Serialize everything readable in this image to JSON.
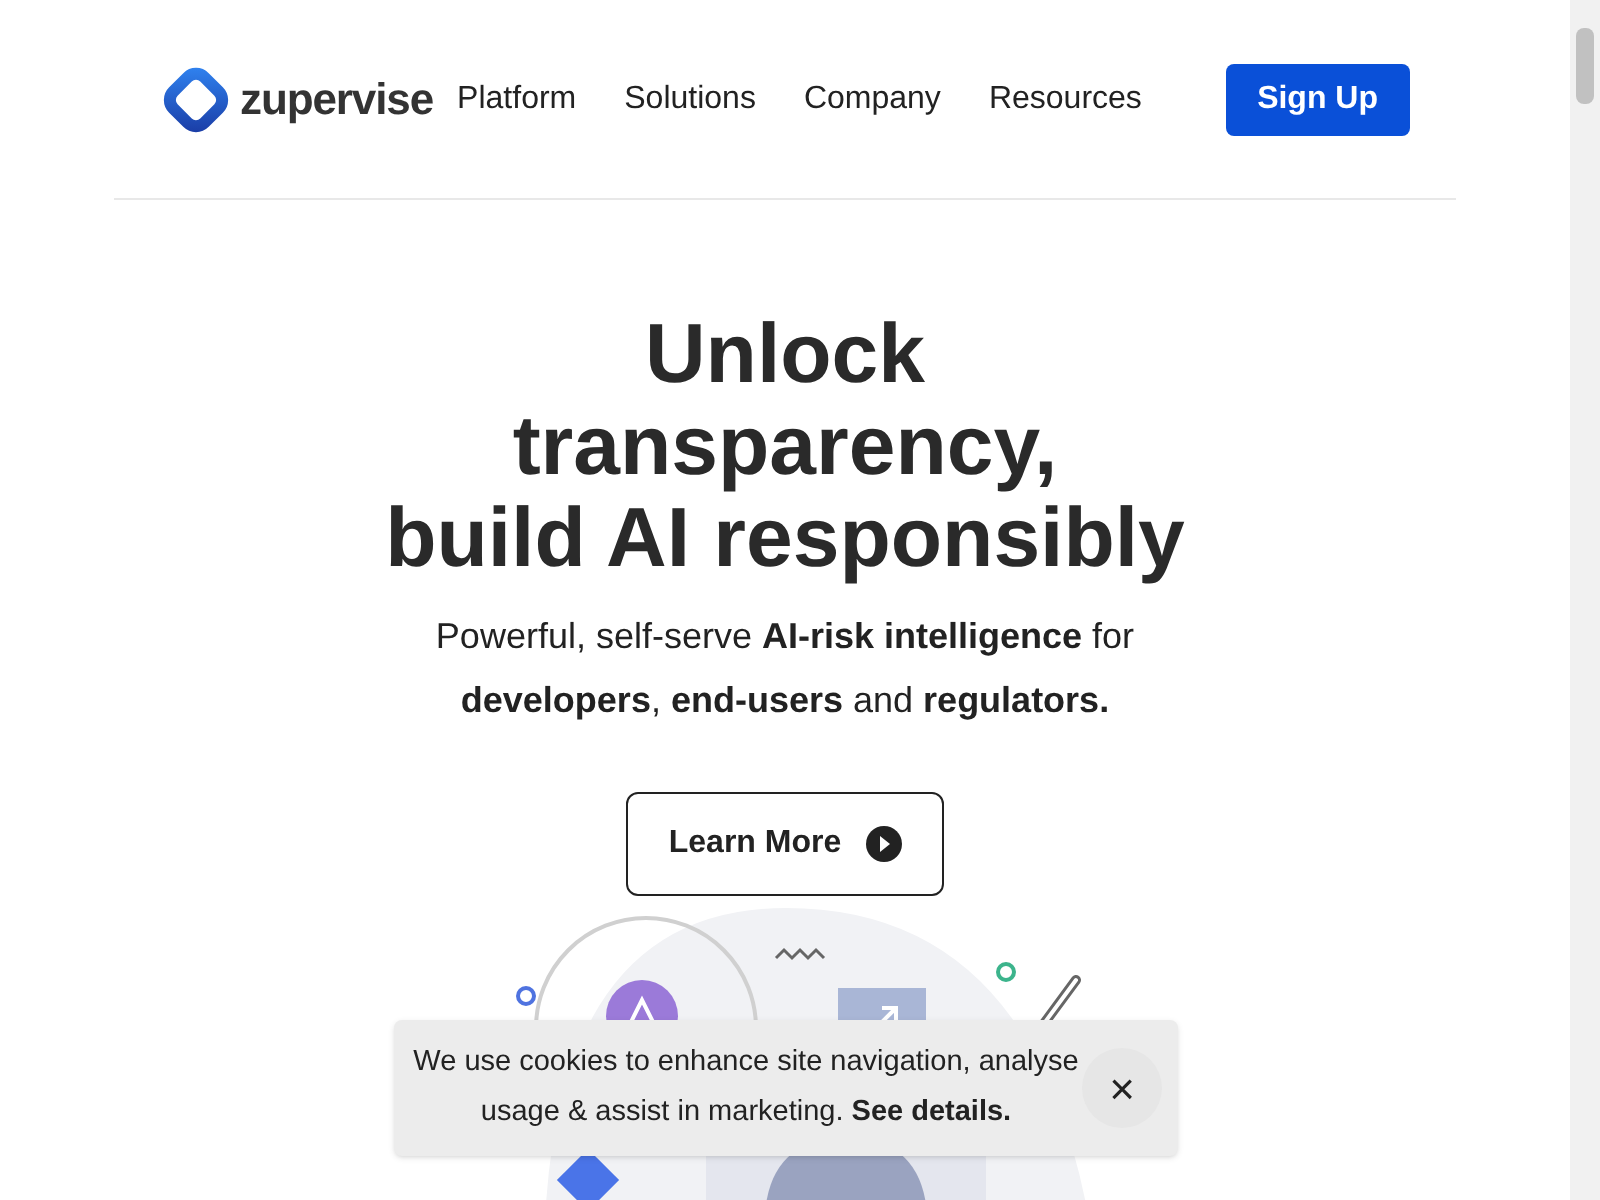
{
  "header": {
    "logo_text": "zupervise",
    "nav": [
      "Platform",
      "Solutions",
      "Company",
      "Resources"
    ],
    "cta": "Sign Up"
  },
  "hero": {
    "title_lines": [
      "Unlock",
      "transparency,",
      "build AI responsibly"
    ],
    "subtitle": "Powerful, self-serve **AI-risk intelligence** for **developers**, **end-users** and **regulators.**",
    "button": "Learn More"
  },
  "cookie_banner": {
    "message": "We use cookies to enhance site navigation, analyse usage & assist in marketing. **See details.**",
    "close": "×"
  }
}
